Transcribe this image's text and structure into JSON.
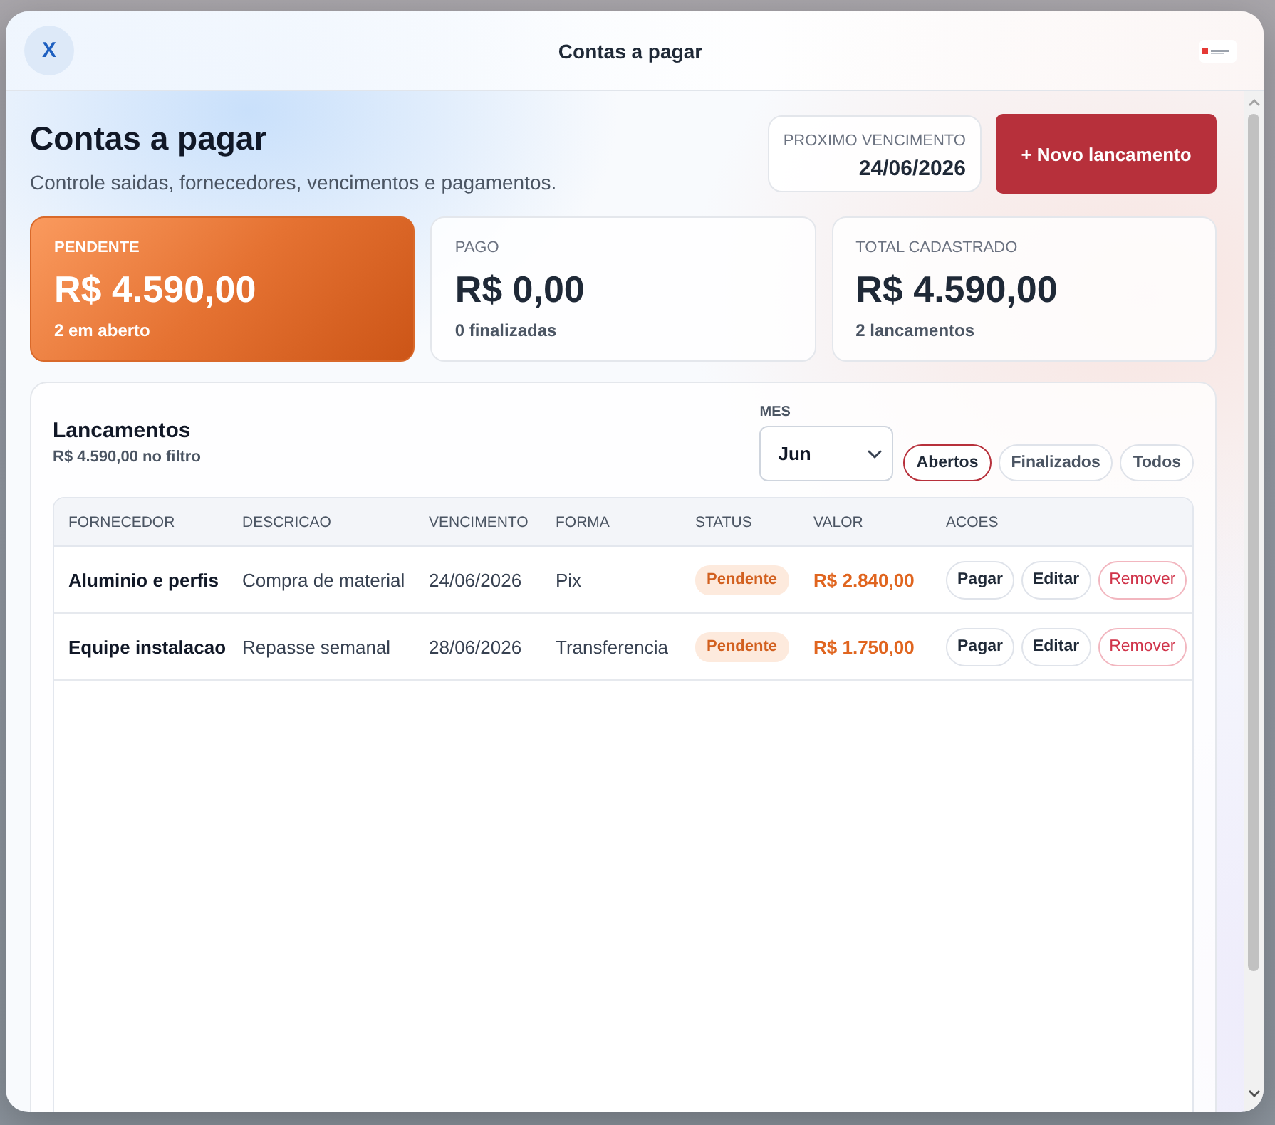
{
  "window": {
    "title": "Contas a pagar",
    "close_label": "X"
  },
  "header": {
    "title": "Contas a pagar",
    "subtitle": "Controle saidas, fornecedores, vencimentos e pagamentos.",
    "next_due": {
      "label": "PROXIMO VENCIMENTO",
      "value": "24/06/2026"
    },
    "new_button": "+ Novo lancamento"
  },
  "summary_cards": [
    {
      "kind": "highlight",
      "label": "PENDENTE",
      "value": "R$ 4.590,00",
      "detail": "2 em aberto"
    },
    {
      "kind": "plain",
      "label": "PAGO",
      "value": "R$ 0,00",
      "detail": "0 finalizadas"
    },
    {
      "kind": "plain",
      "label": "TOTAL CADASTRADO",
      "value": "R$ 4.590,00",
      "detail": "2 lancamentos"
    }
  ],
  "entries_panel": {
    "title": "Lancamentos",
    "subtitle": "R$ 4.590,00 no filtro",
    "month_filter": {
      "label": "MES",
      "value": "Jun"
    },
    "status_filters": [
      {
        "label": "Abertos",
        "selected": true
      },
      {
        "label": "Finalizados",
        "selected": false
      },
      {
        "label": "Todos",
        "selected": false
      }
    ],
    "table": {
      "columns": [
        "FORNECEDOR",
        "DESCRICAO",
        "VENCIMENTO",
        "FORMA",
        "STATUS",
        "VALOR",
        "ACOES"
      ],
      "rows": [
        {
          "supplier": "Aluminio e perfis",
          "description": "Compra de material",
          "due_date": "24/06/2026",
          "method": "Pix",
          "status": {
            "label": "Pendente",
            "kind": "pending"
          },
          "amount": "R$ 2.840,00",
          "actions": [
            {
              "label": "Pagar",
              "kind": "default"
            },
            {
              "label": "Editar",
              "kind": "default"
            },
            {
              "label": "Remover",
              "kind": "danger"
            }
          ]
        },
        {
          "supplier": "Equipe instalacao",
          "description": "Repasse semanal",
          "due_date": "28/06/2026",
          "method": "Transferencia",
          "status": {
            "label": "Pendente",
            "kind": "pending"
          },
          "amount": "R$ 1.750,00",
          "actions": [
            {
              "label": "Pagar",
              "kind": "default"
            },
            {
              "label": "Editar",
              "kind": "default"
            },
            {
              "label": "Remover",
              "kind": "danger"
            }
          ]
        }
      ]
    }
  }
}
